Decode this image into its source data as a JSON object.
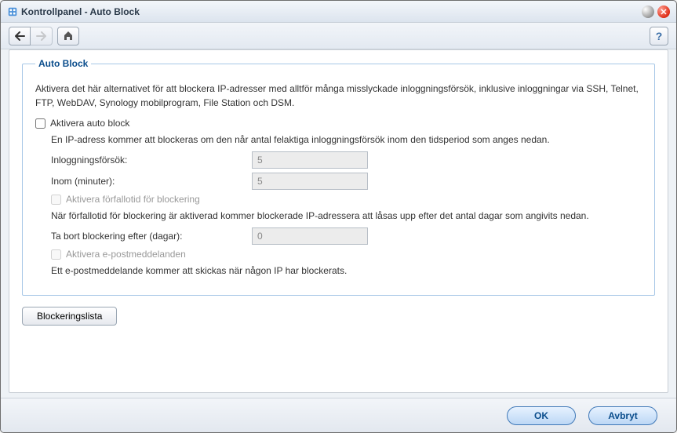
{
  "title": "Kontrollpanel - Auto Block",
  "toolbar": {
    "back_label": "Back",
    "forward_label": "Forward",
    "home_label": "Home",
    "help_label": "Help"
  },
  "section": {
    "legend": "Auto Block",
    "description": "Aktivera det här alternativet för att blockera IP-adresser med alltför många misslyckade inloggningsförsök, inklusive inloggningar via SSH, Telnet, FTP, WebDAV, Synology mobilprogram, File Station och DSM.",
    "enable_autoblock_label": "Aktivera auto block",
    "enable_autoblock_checked": false,
    "autoblock_note": "En IP-adress kommer att blockeras om den når antal felaktiga inloggningsförsök inom den tidsperiod som anges nedan.",
    "login_attempts_label": "Inloggningsförsök:",
    "login_attempts_value": "5",
    "within_minutes_label": "Inom (minuter):",
    "within_minutes_value": "5",
    "enable_expiry_label": "Aktivera förfallotid för blockering",
    "enable_expiry_checked": false,
    "expiry_note": "När förfallotid för blockering är aktiverad kommer blockerade IP-adressera att låsas upp efter det antal dagar som angivits nedan.",
    "unblock_days_label": "Ta bort blockering efter (dagar):",
    "unblock_days_value": "0",
    "enable_email_label": "Aktivera e-postmeddelanden",
    "enable_email_checked": false,
    "email_note": "Ett e-postmeddelande kommer att skickas när någon IP har blockerats."
  },
  "blocklist_button": "Blockeringslista",
  "footer": {
    "ok": "OK",
    "cancel": "Avbryt"
  }
}
